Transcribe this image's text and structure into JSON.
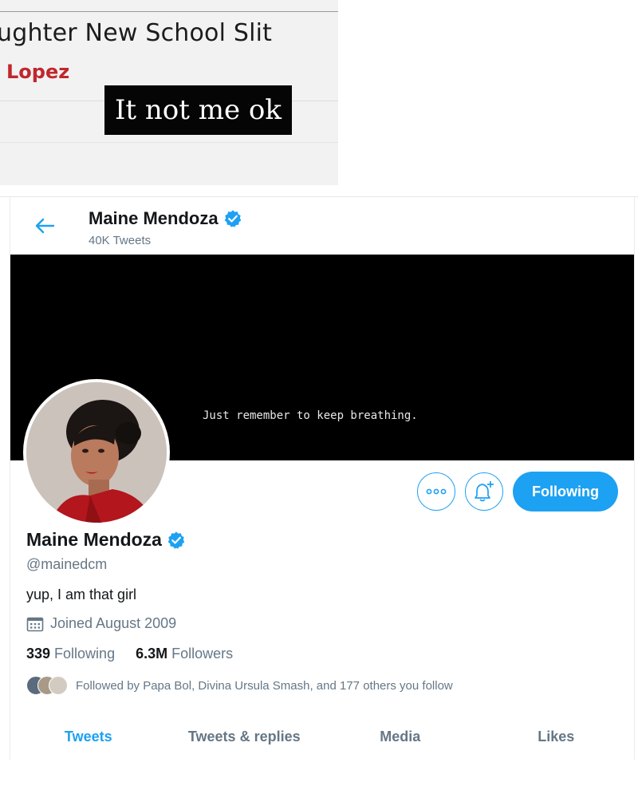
{
  "article_fragment": {
    "title": "ughter New School Slit",
    "author": "Lopez",
    "caption": "It not me ok"
  },
  "profile_header": {
    "name": "Maine Mendoza",
    "tweet_count": "40K Tweets"
  },
  "banner": {
    "text": "Just remember to keep breathing."
  },
  "actions": {
    "more_icon": "more-options-icon",
    "notify_icon": "bell-plus-icon",
    "follow_label": "Following"
  },
  "profile": {
    "display_name": "Maine Mendoza",
    "handle": "@mainedcm",
    "bio": "yup, I am that girl",
    "joined": "Joined August 2009",
    "following_count": "339",
    "following_label": "Following",
    "followers_count": "6.3M",
    "followers_label": "Followers",
    "followed_by": "Followed by Papa Bol, Divina Ursula Smash, and 177 others you follow"
  },
  "tabs": [
    {
      "label": "Tweets",
      "active": true
    },
    {
      "label": "Tweets & replies",
      "active": false
    },
    {
      "label": "Media",
      "active": false
    },
    {
      "label": "Likes",
      "active": false
    }
  ],
  "colors": {
    "accent": "#1da1f2",
    "secondary_text": "#657786",
    "caption_bg": "#050505",
    "author_red": "#c0272d"
  }
}
